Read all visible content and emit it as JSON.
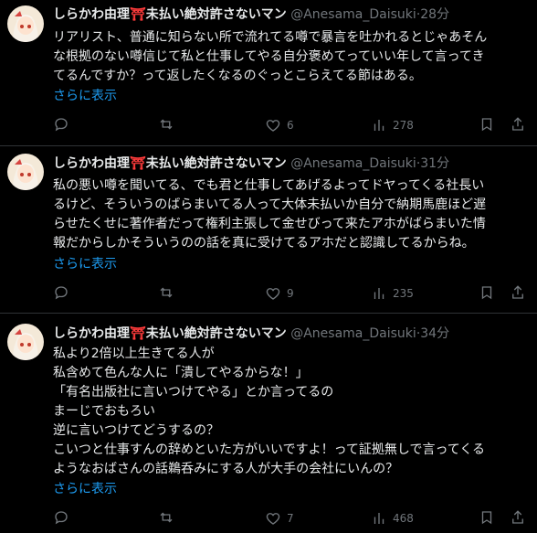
{
  "colors": {
    "accent": "#1d9bf0",
    "text": "#e7e9ea",
    "muted": "#71767b",
    "divider": "#2f3336",
    "torii": "#ff3b3b"
  },
  "tweets": [
    {
      "name": "しらかわ由理",
      "name_suffix": "未払い絶対許さないマン",
      "handle": "@Anesama_Daisuki",
      "sep": "·",
      "time": "28分",
      "lines": [
        "リアリスト、普通に知らない所で流れてる噂で暴言を吐かれるとじゃあそん",
        "な根拠のない噂信じて私と仕事してやる自分褒めてっていい年して言ってき",
        "てるんですか？って返したくなるのぐっとこらえてる節はある。"
      ],
      "more": "さらに表示",
      "replies": "",
      "retweets": "",
      "likes": "6",
      "views": "278"
    },
    {
      "name": "しらかわ由理",
      "name_suffix": "未払い絶対許さないマン",
      "handle": "@Anesama_Daisuki",
      "sep": "·",
      "time": "31分",
      "lines": [
        "私の悪い噂を聞いてる、でも君と仕事してあげるよってドヤってくる社長い",
        "るけど、そういうのばらまいてる人って大体未払いか自分で納期馬鹿ほど遅",
        "らせたくせに著作者だって権利主張して金せびって来たアホがばらまいた情",
        "報だからしかそういうのの話を真に受けてるアホだと認識してるからね。"
      ],
      "more": "さらに表示",
      "replies": "",
      "retweets": "",
      "likes": "9",
      "views": "235"
    },
    {
      "name": "しらかわ由理",
      "name_suffix": "未払い絶対許さないマン",
      "handle": "@Anesama_Daisuki",
      "sep": "·",
      "time": "34分",
      "lines": [
        "私より2倍以上生きてる人が",
        "私含めて色んな人に「潰してやるからな！」",
        "「有名出版社に言いつけてやる」とか言ってるの",
        "まーじでおもろい",
        "逆に言いつけてどうするの？",
        "こいつと仕事すんの辞めといた方がいいですよ！って証拠無しで言ってくる",
        "ようなおばさんの話鵜呑みにする人が大手の会社にいんの？"
      ],
      "more": "さらに表示",
      "replies": "",
      "retweets": "",
      "likes": "7",
      "views": "468"
    }
  ]
}
